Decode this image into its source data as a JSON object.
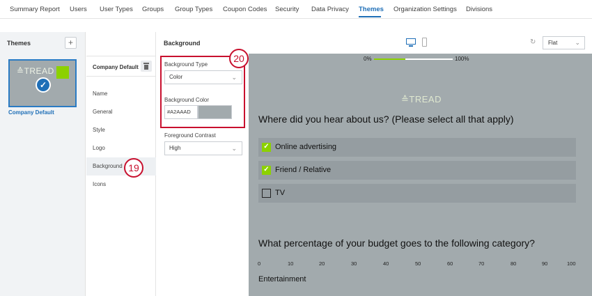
{
  "nav": {
    "tabs": [
      {
        "label": "Summary Report"
      },
      {
        "label": "Users"
      },
      {
        "label": "User Types"
      },
      {
        "label": "Groups"
      },
      {
        "label": "Group Types"
      },
      {
        "label": "Coupon Codes"
      },
      {
        "label": "Security"
      },
      {
        "label": "Data Privacy"
      },
      {
        "label": "Themes",
        "active": true
      },
      {
        "label": "Organization Settings"
      },
      {
        "label": "Divisions"
      }
    ]
  },
  "themes_panel": {
    "title": "Themes",
    "add_label": "+",
    "theme": {
      "name": "Company Default",
      "logo_text": "TREAD",
      "selected": true
    }
  },
  "settings_nav": {
    "header": "Company Default",
    "items": [
      "Name",
      "General",
      "Style",
      "Logo",
      "Background",
      "Icons"
    ],
    "selected": "Background"
  },
  "background_form": {
    "title": "Background",
    "type_label": "Background Type",
    "type_value": "Color",
    "color_label": "Background Color",
    "color_value": "#A2AAAD",
    "contrast_label": "Foreground Contrast",
    "contrast_value": "High"
  },
  "preview_header": {
    "view_mode": "Flat"
  },
  "preview": {
    "background_color": "#A2AAAD",
    "progress": {
      "start_label": "0%",
      "end_label": "100%",
      "fraction": 0.4
    },
    "logo_text": "TREAD",
    "q1": "Where did you hear about us? (Please select all that apply)",
    "choices": [
      {
        "label": "Online advertising",
        "checked": true
      },
      {
        "label": "Friend / Relative",
        "checked": true
      },
      {
        "label": "TV",
        "checked": false
      }
    ],
    "q2": "What percentage of your budget goes to the following category?",
    "scale": [
      "0",
      "10",
      "20",
      "30",
      "40",
      "50",
      "60",
      "70",
      "80",
      "90",
      "100"
    ],
    "row_label": "Entertainment"
  },
  "badges": {
    "step_19": "19",
    "step_20": "20"
  },
  "colors": {
    "accent": "#1f6fb7",
    "brand_green": "#8cd100",
    "highlight_red": "#c8102e"
  }
}
